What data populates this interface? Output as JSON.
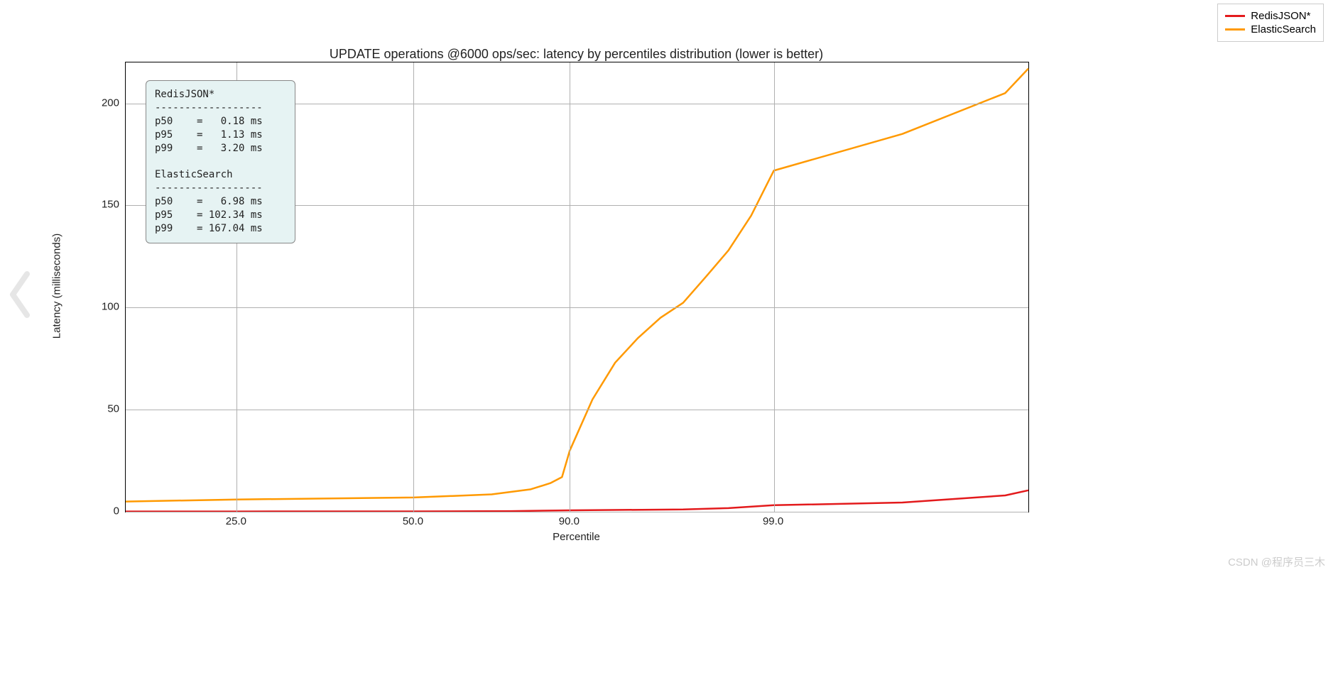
{
  "chart_data": {
    "type": "line",
    "title": "UPDATE operations @6000 ops/sec: latency by percentiles distribution (lower is better)",
    "xlabel": "Percentile",
    "ylabel": "Latency (milliseconds)",
    "ylim": [
      0,
      220
    ],
    "xticks": [
      "25.0",
      "50.0",
      "90.0",
      "99.0"
    ],
    "yticks": [
      0,
      50,
      100,
      150,
      200
    ],
    "x_scale_note": "nonlinear percentile axis (tail-expanded)",
    "series": [
      {
        "name": "RedisJSON*",
        "color": "#e31a1c",
        "points": [
          {
            "p": 10,
            "v": 0.12
          },
          {
            "p": 25,
            "v": 0.15
          },
          {
            "p": 50,
            "v": 0.18
          },
          {
            "p": 75,
            "v": 0.3
          },
          {
            "p": 90,
            "v": 0.7
          },
          {
            "p": 95,
            "v": 1.13
          },
          {
            "p": 97,
            "v": 1.8
          },
          {
            "p": 99,
            "v": 3.2
          },
          {
            "p": 99.5,
            "v": 4.5
          },
          {
            "p": 99.9,
            "v": 8.0
          },
          {
            "p": 99.99,
            "v": 10.5
          }
        ]
      },
      {
        "name": "ElasticSearch",
        "color": "#ff9900",
        "points": [
          {
            "p": 10,
            "v": 5.0
          },
          {
            "p": 25,
            "v": 6.0
          },
          {
            "p": 50,
            "v": 6.98
          },
          {
            "p": 70,
            "v": 8.5
          },
          {
            "p": 80,
            "v": 11.0
          },
          {
            "p": 85,
            "v": 14.0
          },
          {
            "p": 88,
            "v": 17.0
          },
          {
            "p": 90,
            "v": 30.0
          },
          {
            "p": 91,
            "v": 55.0
          },
          {
            "p": 92,
            "v": 73.0
          },
          {
            "p": 93,
            "v": 85.0
          },
          {
            "p": 94,
            "v": 95.0
          },
          {
            "p": 95,
            "v": 102.34
          },
          {
            "p": 96,
            "v": 115.0
          },
          {
            "p": 97,
            "v": 128.0
          },
          {
            "p": 98,
            "v": 145.0
          },
          {
            "p": 99,
            "v": 167.04
          },
          {
            "p": 99.5,
            "v": 185.0
          },
          {
            "p": 99.9,
            "v": 205.0
          },
          {
            "p": 99.99,
            "v": 217.0
          }
        ]
      }
    ],
    "annotation_box": "RedisJSON*\n------------------\np50    =   0.18 ms\np95    =   1.13 ms\np99    =   3.20 ms\n\nElasticSearch\n------------------\np50    =   6.98 ms\np95    = 102.34 ms\np99    = 167.04 ms"
  },
  "legend": {
    "items": [
      "RedisJSON*",
      "ElasticSearch"
    ]
  },
  "watermark": "CSDN @程序员三木"
}
